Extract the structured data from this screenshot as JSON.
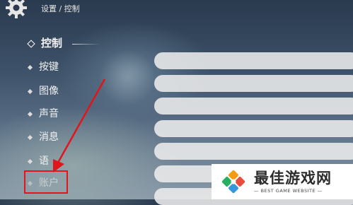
{
  "header": {
    "breadcrumb": "设置 / 控制"
  },
  "sidebar": {
    "items": [
      {
        "label": "控制",
        "active": true
      },
      {
        "label": "按键"
      },
      {
        "label": "图像"
      },
      {
        "label": "声音"
      },
      {
        "label": "消息"
      },
      {
        "label": "语"
      },
      {
        "label": "账户",
        "highlighted": true
      }
    ]
  },
  "main": {
    "section_label": "",
    "rows": [
      "",
      "",
      "",
      "",
      "",
      "",
      ""
    ]
  },
  "annotation": {
    "color": "#e0161b"
  },
  "watermark": {
    "title": "最佳游戏网",
    "subtitle": "BEST GAME WEBSITE"
  }
}
